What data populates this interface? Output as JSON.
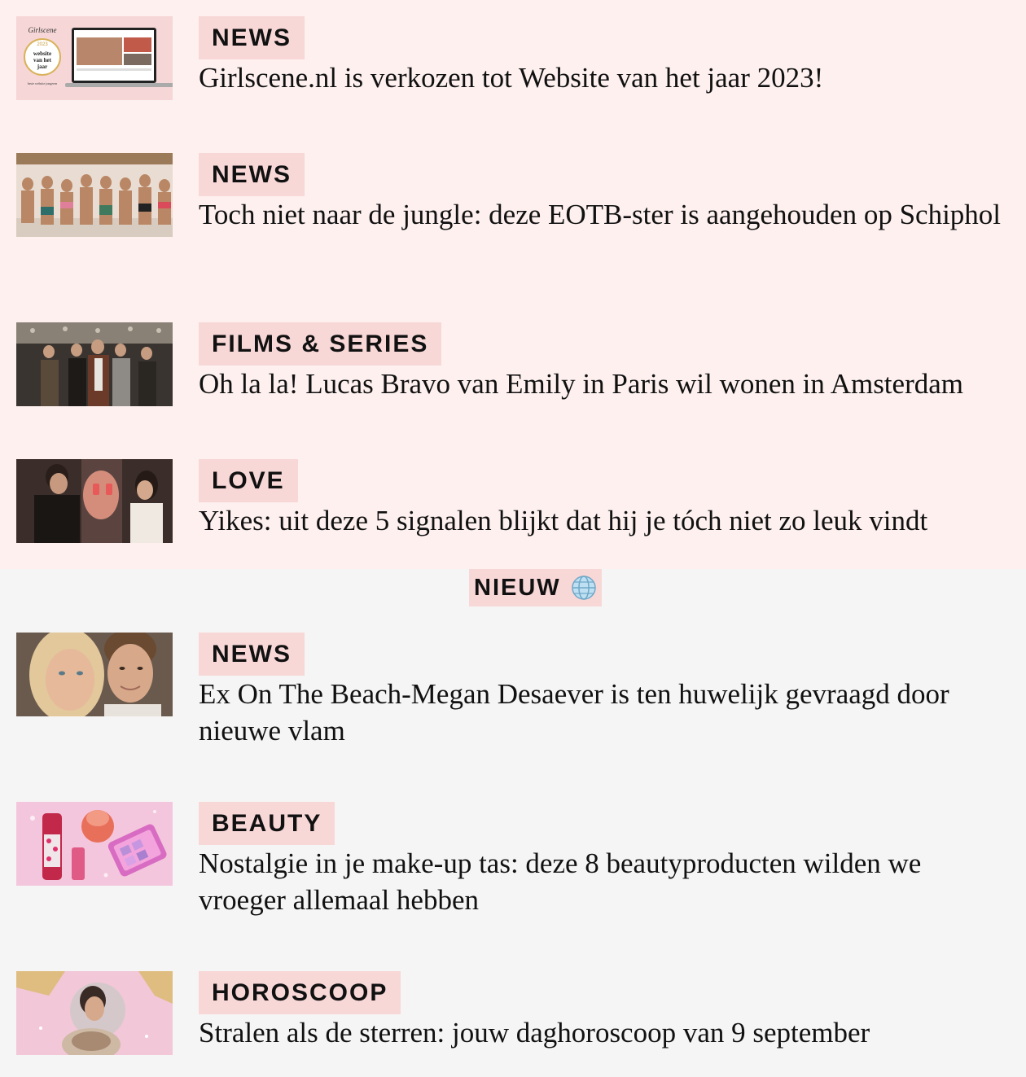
{
  "nieuw": {
    "label": "NIEUW",
    "icon": "globe-icon"
  },
  "articles": [
    {
      "category": "NEWS",
      "title": "Girlscene.nl is verkozen tot Website van het jaar 2023!",
      "thumb": {
        "badge": "website van het jaar",
        "logo": "Girlscene",
        "year": "2023",
        "caption": "beste website jongeren"
      }
    },
    {
      "category": "NEWS",
      "title": "Toch niet naar de jungle: deze EOTB-ster is aangehouden op Schiphol"
    },
    {
      "category": "FILMS & SERIES",
      "title": "Oh la la! Lucas Bravo van Emily in Paris wil wonen in Amsterdam"
    },
    {
      "category": "LOVE",
      "title": "Yikes: uit deze 5 signalen blijkt dat hij je tóch niet zo leuk vindt"
    },
    {
      "category": "NEWS",
      "title": "Ex On The Beach-Megan Desaever is ten huwelijk gevraagd door nieuwe vlam"
    },
    {
      "category": "BEAUTY",
      "title": "Nostalgie in je make-up tas: deze 8 beautyproducten wilden we vroeger allemaal hebben"
    },
    {
      "category": "HOROSCOOP",
      "title": "Stralen als de sterren: jouw daghoroscoop van 9 september"
    }
  ],
  "colors": {
    "top_bg": "#fdf0ef",
    "bottom_bg": "#f6f5f5",
    "tag_bg": "#f8d7d7",
    "text": "#111111"
  }
}
